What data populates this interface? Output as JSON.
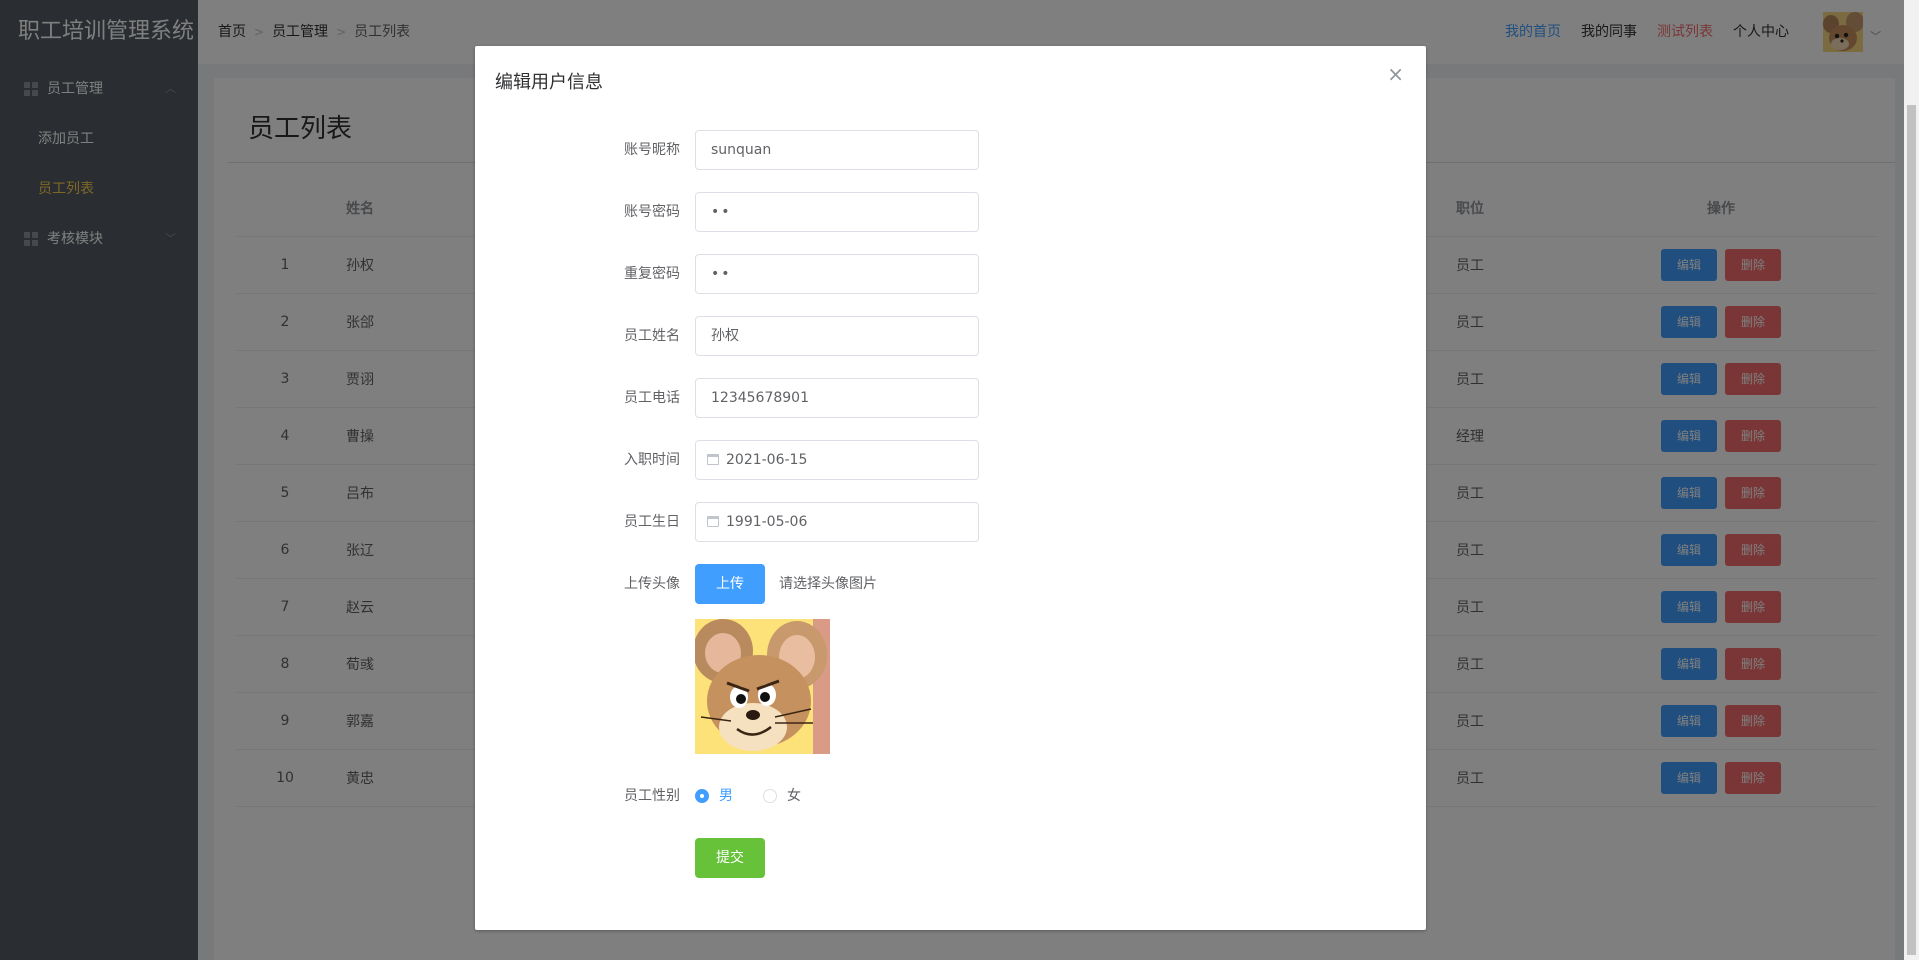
{
  "sidebar": {
    "brand": "职工培训管理系统",
    "groups": [
      {
        "label": "员工管理",
        "icon": "grid-icon",
        "expanded": true,
        "items": [
          {
            "label": "添加员工",
            "active": false
          },
          {
            "label": "员工列表",
            "active": true
          }
        ]
      },
      {
        "label": "考核模块",
        "icon": "grid-icon",
        "expanded": false
      }
    ]
  },
  "header": {
    "breadcrumb": [
      "首页",
      "员工管理",
      "员工列表"
    ],
    "nav": [
      {
        "label": "我的首页",
        "color": "#409eff"
      },
      {
        "label": "我的同事",
        "color": "#303133"
      },
      {
        "label": "测试列表",
        "color": "#f56c6c"
      },
      {
        "label": "个人中心",
        "color": "#303133"
      }
    ]
  },
  "page": {
    "title": "员工列表",
    "columns": {
      "index": "",
      "name": "姓名",
      "position": "职位",
      "actions": "操作"
    },
    "edit_label": "编辑",
    "delete_label": "删除",
    "rows": [
      {
        "index": "1",
        "name": "孙权",
        "position": "员工"
      },
      {
        "index": "2",
        "name": "张郃",
        "position": "员工"
      },
      {
        "index": "3",
        "name": "贾诩",
        "position": "员工"
      },
      {
        "index": "4",
        "name": "曹操",
        "position": "经理"
      },
      {
        "index": "5",
        "name": "吕布",
        "position": "员工"
      },
      {
        "index": "6",
        "name": "张辽",
        "position": "员工"
      },
      {
        "index": "7",
        "name": "赵云",
        "position": "员工"
      },
      {
        "index": "8",
        "name": "荀彧",
        "position": "员工"
      },
      {
        "index": "9",
        "name": "郭嘉",
        "position": "员工"
      },
      {
        "index": "10",
        "name": "黄忠",
        "position": "员工"
      }
    ]
  },
  "dialog": {
    "title": "编辑用户信息",
    "close": "×",
    "fields": {
      "nickname": {
        "label": "账号昵称",
        "value": "sunquan"
      },
      "password": {
        "label": "账号密码",
        "value": "••"
      },
      "repeat_password": {
        "label": "重复密码",
        "value": "••"
      },
      "name": {
        "label": "员工姓名",
        "value": "孙权"
      },
      "phone": {
        "label": "员工电话",
        "value": "12345678901"
      },
      "hire_date": {
        "label": "入职时间",
        "value": "2021-06-15"
      },
      "birthday": {
        "label": "员工生日",
        "value": "1991-05-06"
      },
      "avatar": {
        "label": "上传头像",
        "button": "上传",
        "tip": "请选择头像图片"
      },
      "gender": {
        "label": "员工性别",
        "options": [
          "男",
          "女"
        ],
        "selected": "男"
      }
    },
    "submit": "提交"
  },
  "colors": {
    "sidebar_bg": "#545c64",
    "active_menu": "#ffd04b",
    "primary": "#409eff",
    "danger": "#f56c6c",
    "success": "#67c23a"
  }
}
